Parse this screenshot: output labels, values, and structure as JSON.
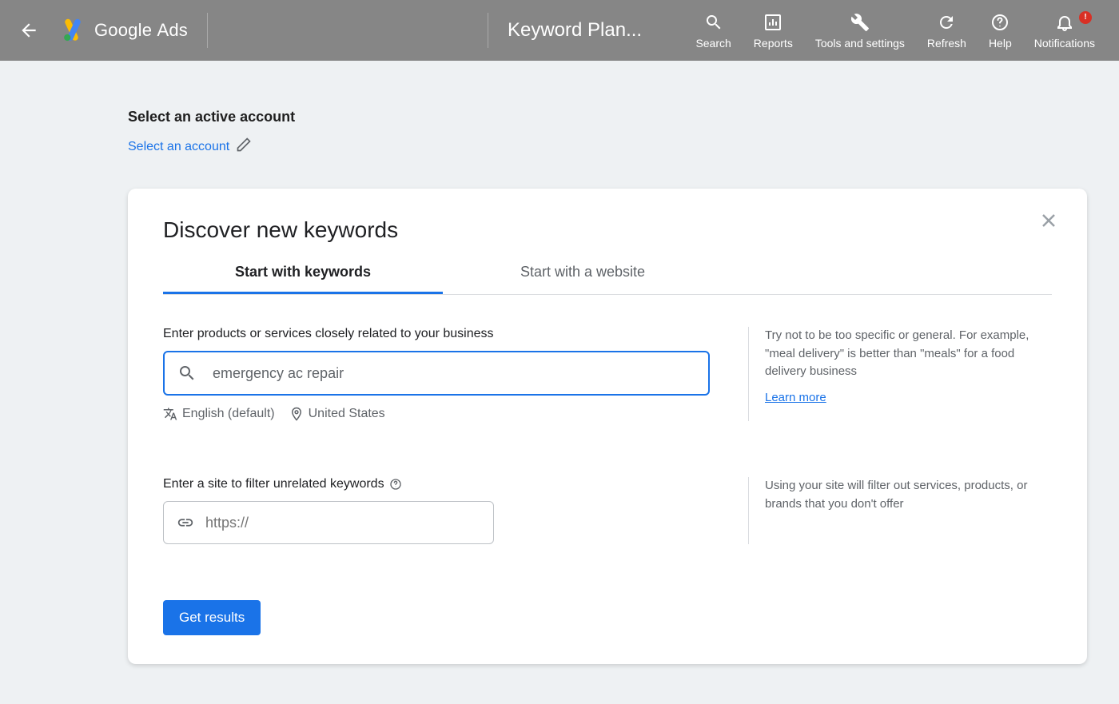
{
  "header": {
    "logo_brand": "Google",
    "logo_product": "Ads",
    "page_title": "Keyword Plan...",
    "actions": {
      "search": "Search",
      "reports": "Reports",
      "tools": "Tools and settings",
      "refresh": "Refresh",
      "help": "Help",
      "notifications": "Notifications"
    },
    "notification_badge": "!"
  },
  "account": {
    "heading": "Select an active account",
    "link": "Select an account"
  },
  "card": {
    "title": "Discover new keywords",
    "tabs": [
      {
        "label": "Start with keywords",
        "active": true
      },
      {
        "label": "Start with a website",
        "active": false
      }
    ],
    "keywords": {
      "label": "Enter products or services closely related to your business",
      "value": "emergency ac repair",
      "language": "English (default)",
      "location": "United States",
      "tip": "Try not to be too specific or general. For example, \"meal delivery\" is better than \"meals\" for a food delivery business",
      "learn_more": "Learn more"
    },
    "site": {
      "label": "Enter a site to filter unrelated keywords",
      "placeholder": "https://",
      "tip": "Using your site will filter out services, products, or brands that you don't offer"
    },
    "button": "Get results"
  }
}
